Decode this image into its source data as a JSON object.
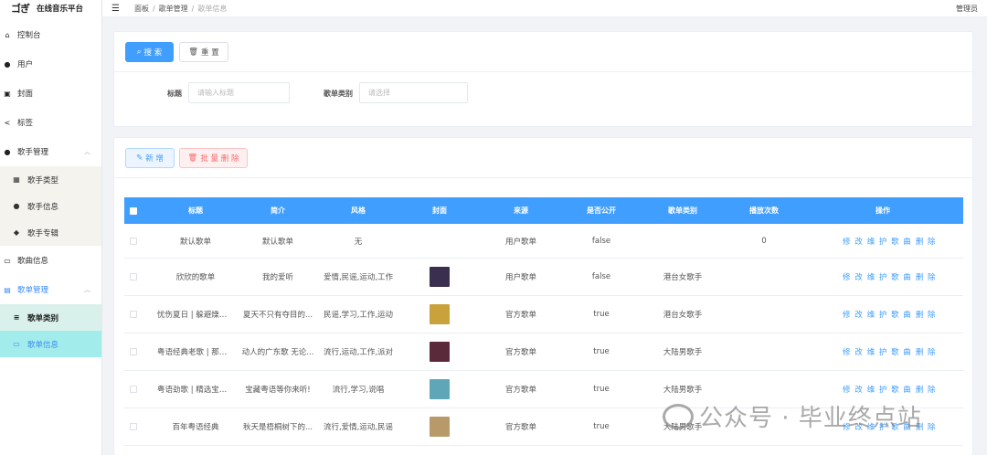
{
  "app": {
    "logo_mark": "ゴぎ",
    "title": "在线音乐平台"
  },
  "sidebar": {
    "items": [
      {
        "label": "控制台",
        "icon": "home-icon"
      },
      {
        "label": "用户",
        "icon": "user-icon"
      },
      {
        "label": "封面",
        "icon": "image-icon"
      },
      {
        "label": "标签",
        "icon": "share-icon"
      }
    ],
    "singer_group": {
      "label": "歌手管理",
      "children": [
        "歌手类型",
        "歌手信息",
        "歌手专辑"
      ]
    },
    "song_info": "歌曲信息",
    "playlist_group": {
      "label": "歌单管理",
      "children": [
        "歌单类别",
        "歌单信息"
      ]
    }
  },
  "topbar": {
    "crumbs": [
      "面板",
      "歌单管理",
      "歌单信息"
    ],
    "user": "管理员"
  },
  "search_card": {
    "search_label": "搜 索",
    "reset_label": "重 置",
    "title_label": "标题",
    "title_placeholder": "请输入标题",
    "category_label": "歌单类别",
    "category_placeholder": "请选择"
  },
  "actions": {
    "add_label": "新 增",
    "batch_delete_label": "批 量 删 除"
  },
  "table": {
    "headers": [
      "标题",
      "简介",
      "风格",
      "封面",
      "来源",
      "是否公开",
      "歌单类别",
      "播放次数",
      "操作"
    ],
    "rows": [
      {
        "title": "默认歌单",
        "intro": "默认歌单",
        "style": "无",
        "cover": "",
        "source": "用户歌单",
        "public": "false",
        "category": "",
        "plays": "0"
      },
      {
        "title": "欣欣的歌单",
        "intro": "我的爱听",
        "style": "爱情,民谣,运动,工作",
        "cover": "#3a2f4e",
        "source": "用户歌单",
        "public": "false",
        "category": "港台女歌手",
        "plays": ""
      },
      {
        "title": "忧伤夏日 | 躲避燥热...",
        "intro": "夏天不只有夺目的...",
        "style": "民谣,学习,工作,运动",
        "cover": "#c9a23c",
        "source": "官方歌单",
        "public": "true",
        "category": "港台女歌手",
        "plays": ""
      },
      {
        "title": "粤语经典老歌 | 那些...",
        "intro": "动人的广东歌 无论...",
        "style": "流行,运动,工作,派对",
        "cover": "#5a2a3a",
        "source": "官方歌单",
        "public": "true",
        "category": "大陆男歌手",
        "plays": ""
      },
      {
        "title": "粤语劲歌 | 精选宝藏...",
        "intro": "宝藏粤语等你来听!",
        "style": "流行,学习,说唱",
        "cover": "#5fa6b8",
        "source": "官方歌单",
        "public": "true",
        "category": "大陆男歌手",
        "plays": ""
      },
      {
        "title": "百年粤语经典",
        "intro": "秋天是梧桐树下的...",
        "style": "流行,爱情,运动,民谣",
        "cover": "#b89a6a",
        "source": "官方歌单",
        "public": "true",
        "category": "大陆男歌手",
        "plays": ""
      }
    ],
    "ops": [
      "修 改",
      "维 护 歌 曲",
      "删 除"
    ]
  },
  "watermark": "公众号 · 毕业终点站"
}
